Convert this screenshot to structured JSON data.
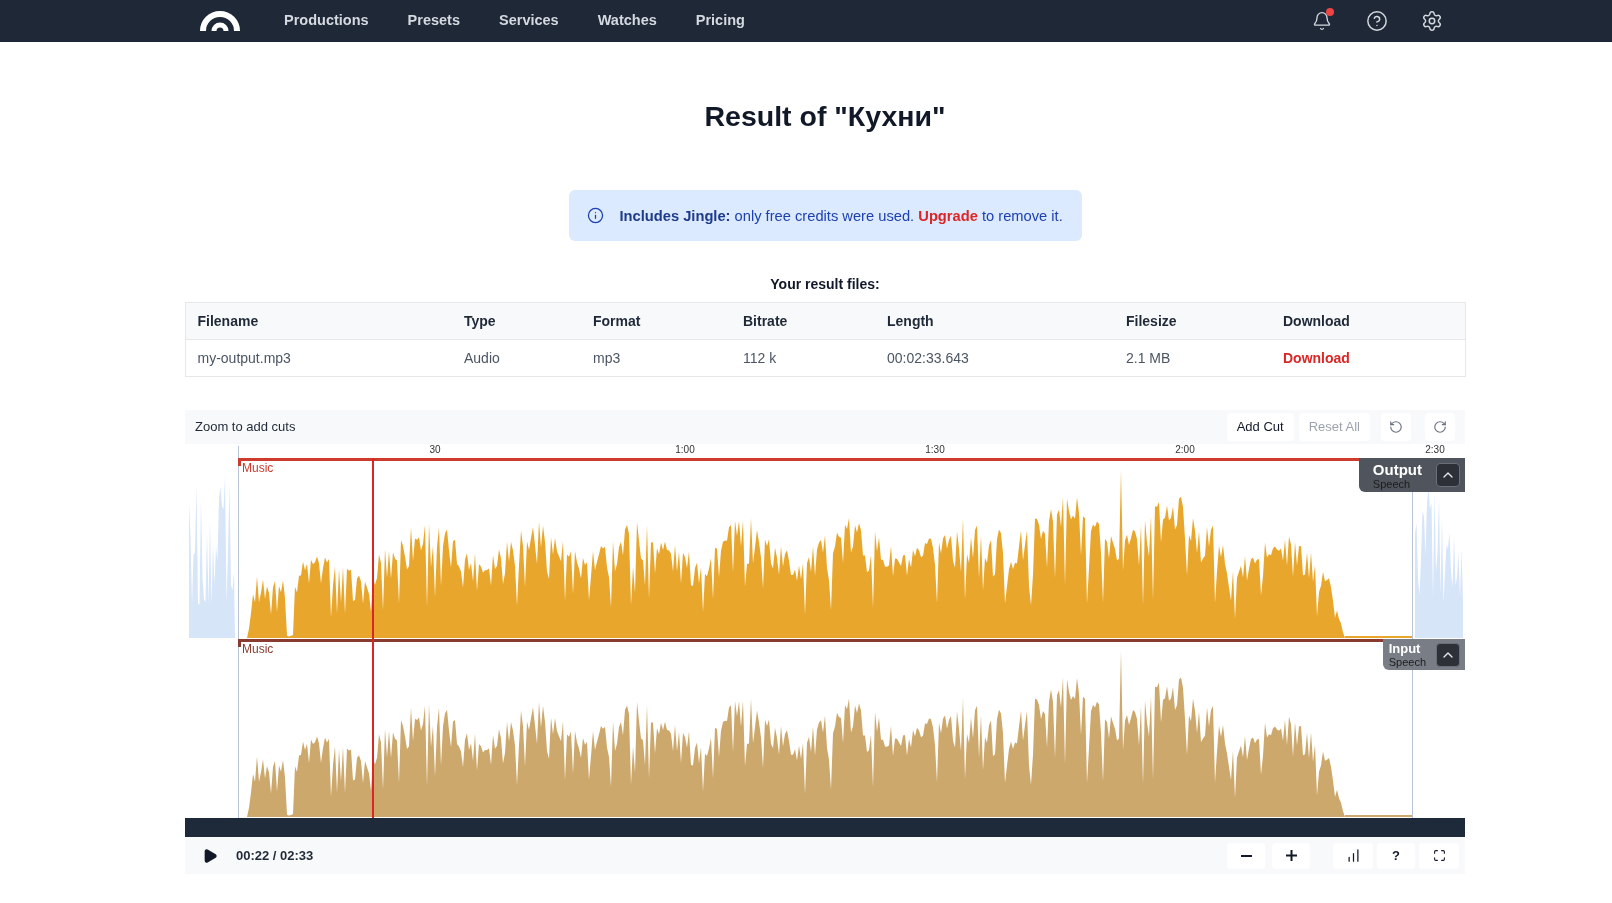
{
  "nav": {
    "items": [
      {
        "label": "Productions"
      },
      {
        "label": "Presets"
      },
      {
        "label": "Services"
      },
      {
        "label": "Watches"
      },
      {
        "label": "Pricing"
      }
    ],
    "notifications": {
      "unread": true
    }
  },
  "title": "Result of \"Кухни\"",
  "notice": {
    "text": "**Includes Jingle:** only free credits were used.",
    "link": "Upgrade",
    "after": "to remove it."
  },
  "result_files": {
    "heading": "Your result files:",
    "columns": [
      "Filename",
      "Type",
      "Format",
      "Bitrate",
      "Length",
      "Filesize",
      "Download"
    ],
    "rows": [
      {
        "cells": [
          "my-output.mp3",
          "Audio",
          "mp3",
          "112 k",
          "00:02:33.643",
          "2.1 MB"
        ],
        "download": "Download"
      }
    ]
  },
  "editor": {
    "hint": "Zoom to add cuts",
    "buttons": [
      {
        "label": "Add Cut",
        "disabled": false
      },
      {
        "label": "Reset All",
        "disabled": true
      }
    ],
    "ruler": [
      "30",
      "1:00",
      "1:30",
      "2:00",
      "2:30"
    ],
    "tracks": [
      {
        "name": "Output",
        "kind": "output",
        "start_label": "Music",
        "end_label": "Speech",
        "expanded": true
      },
      {
        "name": "Input",
        "kind": "input",
        "start_label": "Music",
        "end_label": "Speech",
        "expanded": true
      }
    ]
  },
  "player": {
    "playing": false,
    "level": 0.146,
    "time": "00:22 / 02:33",
    "help": "?"
  }
}
